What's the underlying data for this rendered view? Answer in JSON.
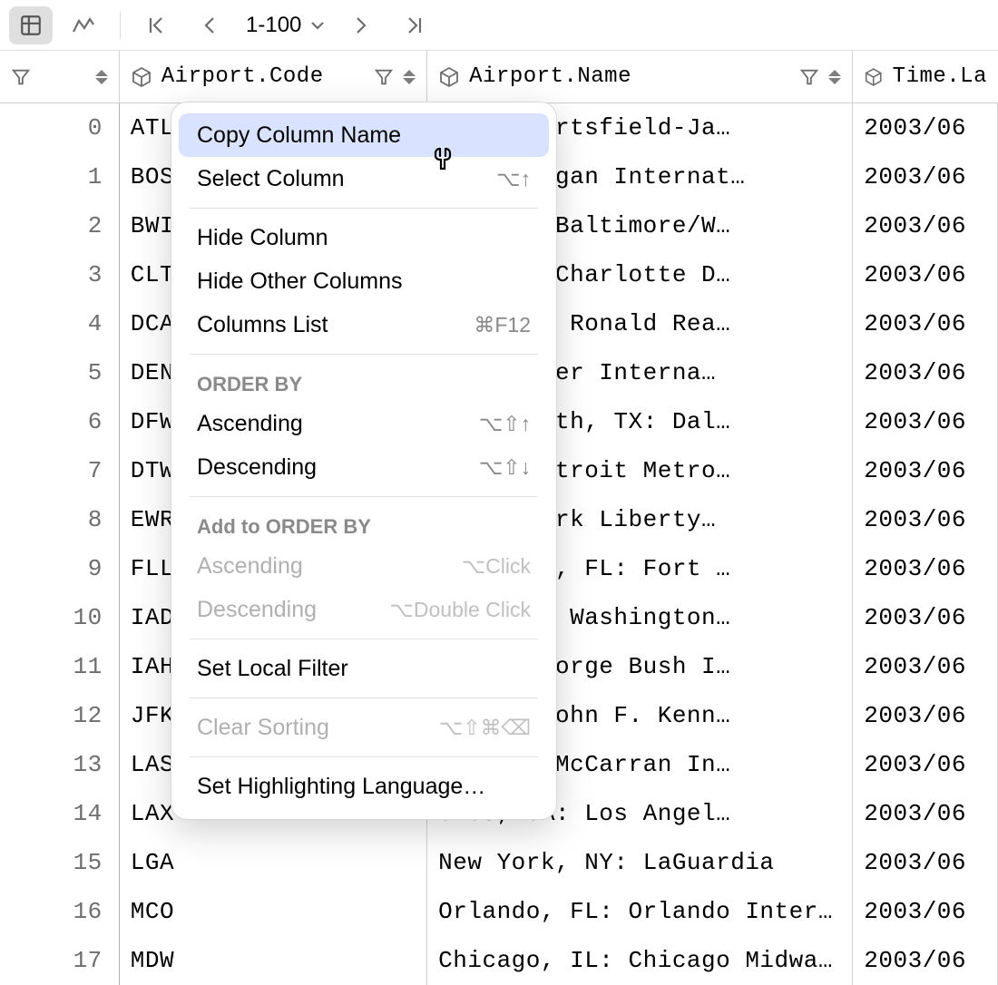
{
  "toolbar": {
    "range": "1-100"
  },
  "columns": {
    "a": "Airport.Code",
    "b": "Airport.Name",
    "c": "Time.La"
  },
  "rows": [
    {
      "n": "0",
      "a": "ATL",
      "b": ", GA: Hartsfield-Ja…",
      "c": "2003/06"
    },
    {
      "n": "1",
      "a": "BOS",
      "b": ", MA: Logan Internat…",
      "c": "2003/06"
    },
    {
      "n": "2",
      "a": "BWI",
      "b": "re, MD: Baltimore/W…",
      "c": "2003/06"
    },
    {
      "n": "3",
      "a": "CLT",
      "b": "te, NC: Charlotte D…",
      "c": "2003/06"
    },
    {
      "n": "4",
      "a": "DCA",
      "b": "ton, DC: Ronald Rea…",
      "c": "2003/06"
    },
    {
      "n": "5",
      "a": "DEN",
      "b": " CO: Denver Interna…",
      "c": "2003/06"
    },
    {
      "n": "6",
      "a": "DFW",
      "b": "Fort Worth, TX: Dal…",
      "c": "2003/06"
    },
    {
      "n": "7",
      "a": "DTW",
      "b": ", MI: Detroit Metro…",
      "c": "2003/06"
    },
    {
      "n": "8",
      "a": "EWR",
      "b": " NJ: Newark Liberty…",
      "c": "2003/06"
    },
    {
      "n": "9",
      "a": "FLL",
      "b": "uderdale, FL: Fort …",
      "c": "2003/06"
    },
    {
      "n": "10",
      "a": "IAD",
      "b": "ton, DC: Washington…",
      "c": "2003/06"
    },
    {
      "n": "11",
      "a": "IAH",
      "b": ", TX: George Bush I…",
      "c": "2003/06"
    },
    {
      "n": "12",
      "a": "JFK",
      "b": "k, NY: John F. Kenn…",
      "c": "2003/06"
    },
    {
      "n": "13",
      "a": "LAS",
      "b": "as, NV: McCarran In…",
      "c": "2003/06"
    },
    {
      "n": "14",
      "a": "LAX",
      "b": "eles, CA: Los Angel…",
      "c": "2003/06"
    },
    {
      "n": "15",
      "a": "LGA",
      "b": "New York, NY: LaGuardia",
      "c": "2003/06"
    },
    {
      "n": "16",
      "a": "MCO",
      "b": "Orlando, FL: Orlando Inter…",
      "c": "2003/06"
    },
    {
      "n": "17",
      "a": "MDW",
      "b": "Chicago, IL: Chicago Midwa…",
      "c": "2003/06"
    }
  ],
  "menu": {
    "copyColumnName": "Copy Column Name",
    "selectColumn": "Select Column",
    "selectColumnSc": "⌥↑",
    "hideColumn": "Hide Column",
    "hideOther": "Hide Other Columns",
    "columnsList": "Columns List",
    "columnsListSc": "⌘F12",
    "orderBy": "ORDER BY",
    "asc": "Ascending",
    "ascSc": "⌥⇧↑",
    "desc": "Descending",
    "descSc": "⌥⇧↓",
    "addOrderBy": "Add to ORDER BY",
    "addAsc": "Ascending",
    "addAscSc": "⌥Click",
    "addDesc": "Descending",
    "addDescSc": "⌥Double Click",
    "setFilter": "Set Local Filter",
    "clearSort": "Clear Sorting",
    "clearSortSc": "⌥⇧⌘⌫",
    "setLang": "Set Highlighting Language…"
  }
}
